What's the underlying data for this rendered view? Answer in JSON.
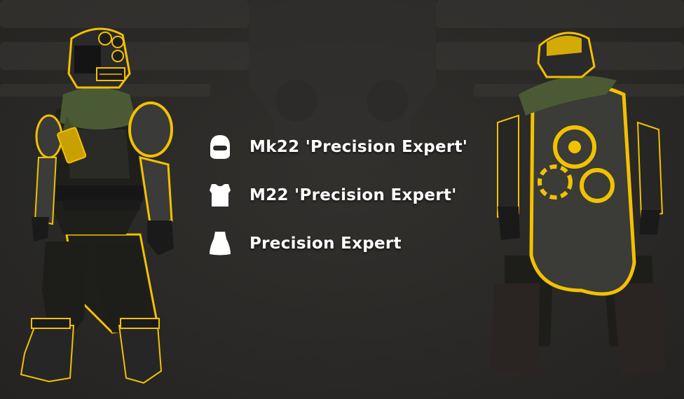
{
  "colors": {
    "background": "#2a2927",
    "accent_yellow": "#f2c100",
    "armor_dark": "#1c1c1c",
    "scarf_green": "#4a5a35",
    "text": "#ffffff"
  },
  "items": [
    {
      "label": "Mk22 'Precision Expert'",
      "icon": "helmet-icon"
    },
    {
      "label": "M22 'Precision Expert'",
      "icon": "chest-armor-icon"
    },
    {
      "label": "Precision Expert",
      "icon": "cape-icon"
    }
  ]
}
